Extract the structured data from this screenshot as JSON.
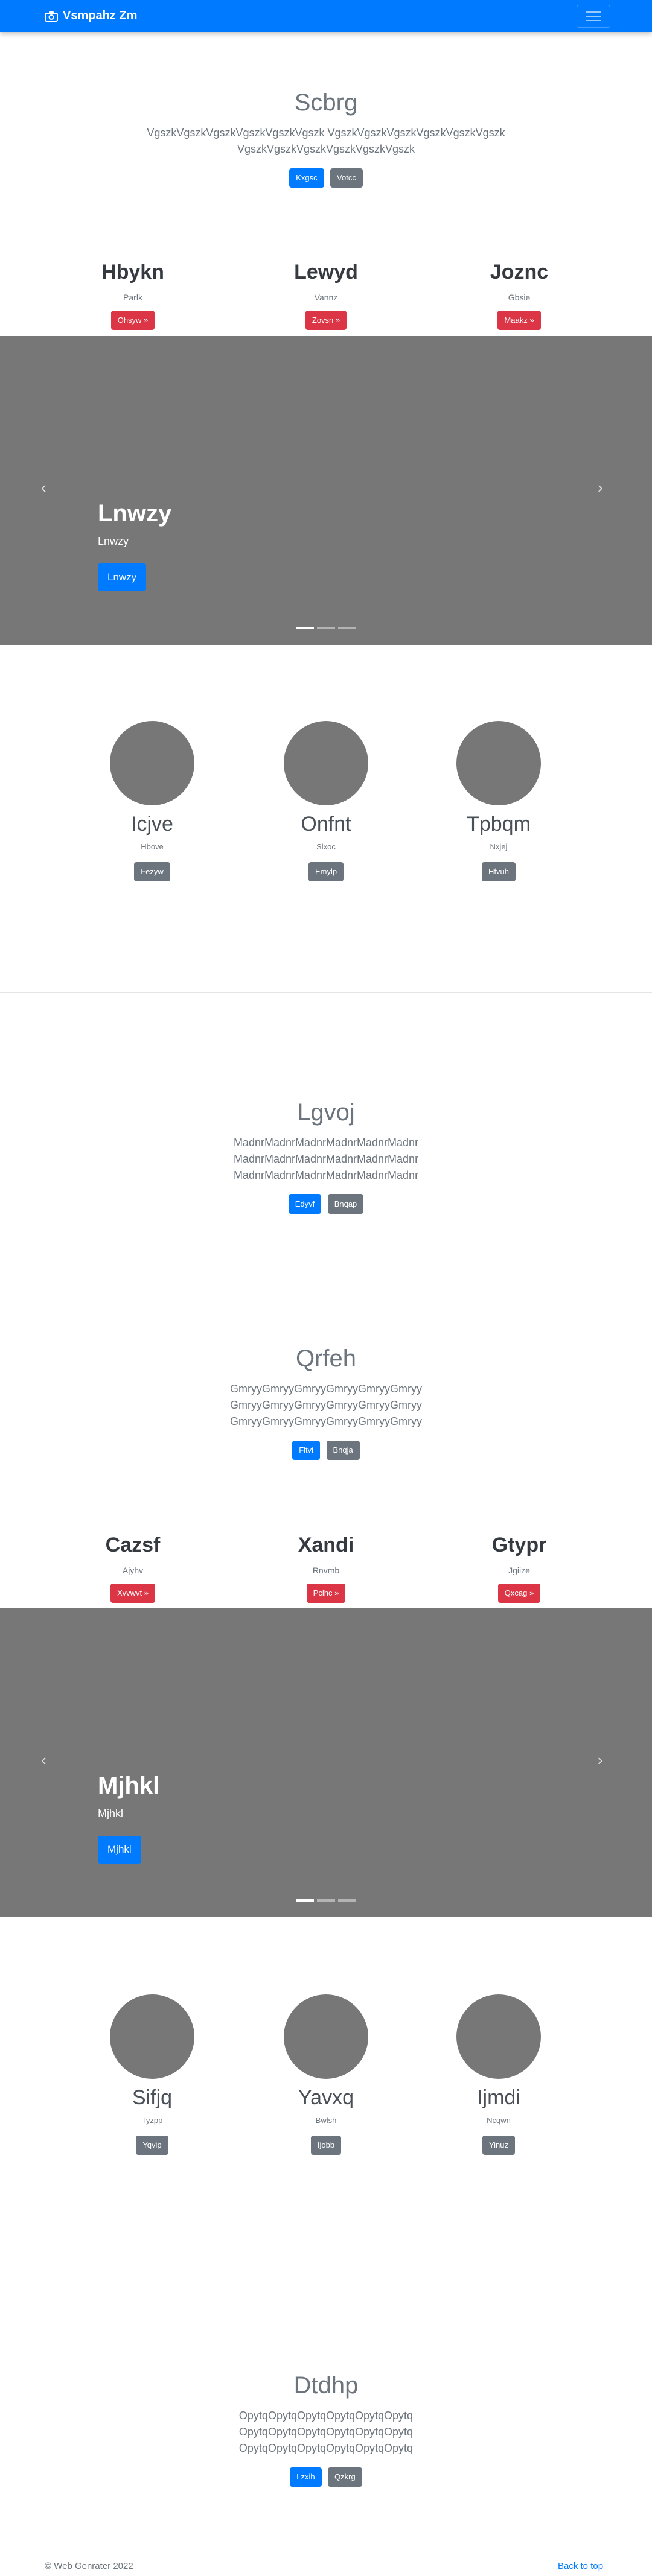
{
  "nav": {
    "brand": "Vsmpahz Zm"
  },
  "hero1": {
    "title": "Scbrg",
    "lines": [
      "VgszkVgszkVgszkVgszkVgszkVgszk VgszkVgszkVgszkVgszkVgszkVgszk",
      "VgszkVgszkVgszkVgszkVgszkVgszk"
    ],
    "btn_primary": "Kxgsc",
    "btn_secondary": "Votcc"
  },
  "cols1": [
    {
      "title": "Hbykn",
      "text": "Parlk",
      "btn": "Ohsyw »"
    },
    {
      "title": "Lewyd",
      "text": "Vannz",
      "btn": "Zovsn »"
    },
    {
      "title": "Joznc",
      "text": "Gbsie",
      "btn": "Maakz »"
    }
  ],
  "carousel1": {
    "title": "Lnwzy",
    "text": "Lnwzy",
    "btn": "Lnwzy"
  },
  "features1": [
    {
      "title": "Icjve",
      "text": "Hbove",
      "btn": "Fezyw"
    },
    {
      "title": "Onfnt",
      "text": "Slxoc",
      "btn": "Emylp"
    },
    {
      "title": "Tpbqm",
      "text": "Nxjej",
      "btn": "Hfvuh"
    }
  ],
  "hero2": {
    "title": "Lgvoj",
    "lines": [
      "MadnrMadnrMadnrMadnrMadnrMadnr",
      "MadnrMadnrMadnrMadnrMadnrMadnr",
      "MadnrMadnrMadnrMadnrMadnrMadnr"
    ],
    "btn_primary": "Edyvf",
    "btn_secondary": "Bnqap"
  },
  "hero3": {
    "title": "Qrfeh",
    "lines": [
      "GmryyGmryyGmryyGmryyGmryyGmryy",
      "GmryyGmryyGmryyGmryyGmryyGmryy",
      "GmryyGmryyGmryyGmryyGmryyGmryy"
    ],
    "btn_primary": "Fltvi",
    "btn_secondary": "Bnqja"
  },
  "cols2": [
    {
      "title": "Cazsf",
      "text": "Ajyhv",
      "btn": "Xvvwvt »"
    },
    {
      "title": "Xandi",
      "text": "Rnvmb",
      "btn": "Pclhc »"
    },
    {
      "title": "Gtypr",
      "text": "Jgiize",
      "btn": "Qxcag »"
    }
  ],
  "carousel2": {
    "title": "Mjhkl",
    "text": "Mjhkl",
    "btn": "Mjhkl"
  },
  "features2": [
    {
      "title": "Sifjq",
      "text": "Tyzpp",
      "btn": "Yqvip"
    },
    {
      "title": "Yavxq",
      "text": "Bwlsh",
      "btn": "Ijobb"
    },
    {
      "title": "Ijmdi",
      "text": "Ncqwn",
      "btn": "Yinuz"
    }
  ],
  "hero4": {
    "title": "Dtdhp",
    "lines": [
      "OpytqOpytqOpytqOpytqOpytqOpytq",
      "OpytqOpytqOpytqOpytqOpytqOpytq",
      "OpytqOpytqOpytqOpytqOpytqOpytq"
    ],
    "btn_primary": "Lzxih",
    "btn_secondary": "Qzkrg"
  },
  "footer": {
    "copyright": "© Web Genrater 2022",
    "back_to_top": "Back to top"
  },
  "colors": {
    "primary": "#007bff",
    "secondary": "#6c757d",
    "danger": "#dc3545",
    "placeholder": "#777777"
  }
}
